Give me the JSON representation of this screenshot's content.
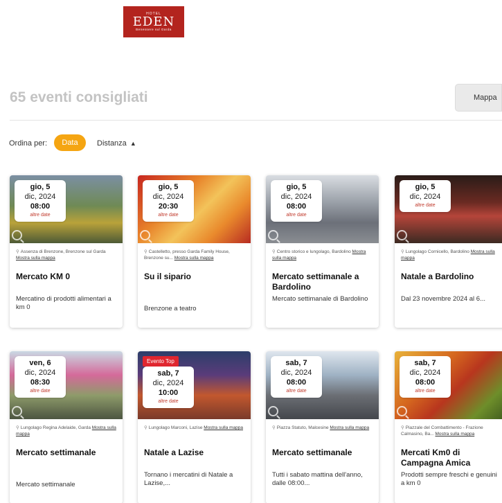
{
  "logo": {
    "top": "HOTEL",
    "name": "EDEN",
    "tagline": "Benessere sul Garda"
  },
  "header": {
    "title": "65 eventi consigliati",
    "map_label": "Mappa"
  },
  "sort": {
    "label": "Ordina per:",
    "date": "Data",
    "distance": "Distanza",
    "distance_arrow": "▲"
  },
  "common": {
    "other_dates": "altre date",
    "show_map": "Mostra sulla mappa"
  },
  "colors": {
    "accent": "#f5a512",
    "logo_bg": "#b3241e",
    "other_dates": "#c0392b",
    "top_event": "#e0262f"
  },
  "events": [
    {
      "day": "gio, 5",
      "month": "dic, 2024",
      "time": "08:00",
      "other": "altre date",
      "location": "Assenza di Brenzone, Brenzone sul Garda",
      "map": "Mostra sulla mappa",
      "title": "Mercato KM 0",
      "desc": "Mercatino di prodotti alimentari a km 0"
    },
    {
      "day": "gio, 5",
      "month": "dic, 2024",
      "time": "20:30",
      "other": "altre date",
      "location": "Castelletto, presso Garda Family House, Brenzone su...",
      "map": "Mostra sulla mappa",
      "title": "Su il sipario",
      "desc": "Brenzone a teatro"
    },
    {
      "day": "gio, 5",
      "month": "dic, 2024",
      "time": "08:00",
      "other": "altre date",
      "location": "Centro storico e lungolago, Bardolino",
      "map": "Mostra sulla mappa",
      "title": "Mercato settimanale a Bardolino",
      "desc": "Mercato settimanale di Bardolino"
    },
    {
      "day": "gio, 5",
      "month": "dic, 2024",
      "time": "",
      "other": "altre date",
      "location": "Lungolago Cornicello, Bardolino",
      "map": "Mostra sulla mappa",
      "title": "Natale a Bardolino",
      "desc": "Dal 23 novembre 2024 al 6..."
    },
    {
      "day": "ven, 6",
      "month": "dic, 2024",
      "time": "08:30",
      "other": "altre date",
      "location": "Lungolago Regina Adelaide, Garda",
      "map": "Mostra sulla mappa",
      "title": "Mercato settimanale",
      "desc": "Mercato settimanale"
    },
    {
      "day": "sab, 7",
      "month": "dic, 2024",
      "time": "10:00",
      "other": "altre date",
      "badge": "Evento Top",
      "location": "Lungolago Marconi, Lazise",
      "map": "Mostra sulla mappa",
      "title": "Natale a Lazise",
      "desc": "Tornano i mercatini di Natale a Lazise,..."
    },
    {
      "day": "sab, 7",
      "month": "dic, 2024",
      "time": "08:00",
      "other": "altre date",
      "location": "Piazza Statuto, Malcesine",
      "map": "Mostra sulla mappa",
      "title": "Mercato settimanale",
      "desc": "Tutti i sabato mattina dell'anno, dalle 08:00..."
    },
    {
      "day": "sab, 7",
      "month": "dic, 2024",
      "time": "08:00",
      "other": "altre date",
      "location": "Piazzale del Combattimento - Frazione Calmasino, Ba...",
      "map": "Mostra sulla mappa",
      "title": "Mercati Km0 di Campagna Amica",
      "desc": "Prodotti sempre freschi e genuini a km 0"
    }
  ]
}
